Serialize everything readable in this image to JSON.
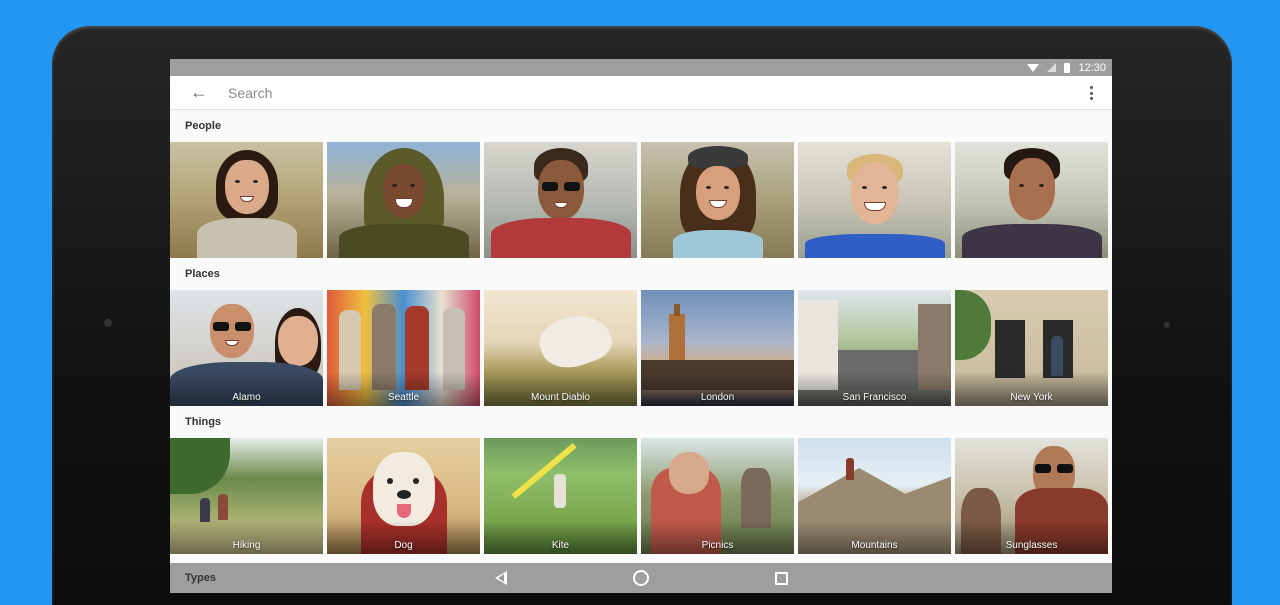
{
  "status_bar": {
    "time": "12:30"
  },
  "search": {
    "placeholder": "Search"
  },
  "sections": {
    "people": {
      "title": "People"
    },
    "places": {
      "title": "Places",
      "items": [
        {
          "label": "Alamo"
        },
        {
          "label": "Seattle"
        },
        {
          "label": "Mount Diablo"
        },
        {
          "label": "London"
        },
        {
          "label": "San Francisco"
        },
        {
          "label": "New York"
        }
      ]
    },
    "things": {
      "title": "Things",
      "items": [
        {
          "label": "Hiking"
        },
        {
          "label": "Dog"
        },
        {
          "label": "Kite"
        },
        {
          "label": "Picnics"
        },
        {
          "label": "Mountains"
        },
        {
          "label": "Sunglasses"
        }
      ]
    },
    "types": {
      "title": "Types"
    }
  },
  "colors": {
    "background": "#2196f3",
    "status_bar": "#9e9e9e",
    "nav_bar": "#9e9e9e",
    "screen": "#fafafa"
  },
  "icons": {
    "back": "arrow-left-icon",
    "overflow": "more-vert-icon",
    "wifi": "wifi-icon",
    "signal": "signal-icon",
    "battery": "battery-icon",
    "nav_back": "triangle-back-icon",
    "nav_home": "circle-home-icon",
    "nav_recent": "square-recents-icon"
  }
}
